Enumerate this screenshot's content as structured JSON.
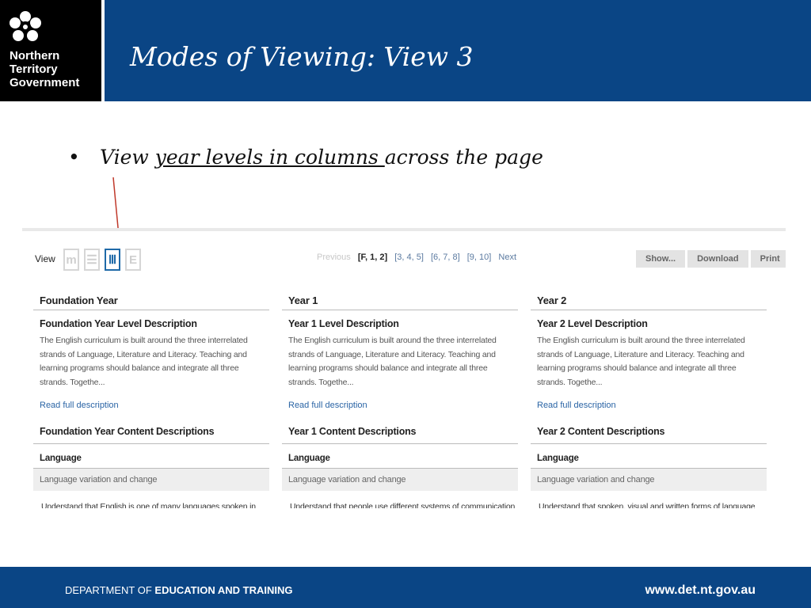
{
  "header": {
    "logo_lines": [
      "Northern",
      "Territory",
      "Government"
    ],
    "title": "Modes of Viewing: View 3"
  },
  "bullet": {
    "prefix": "View ",
    "underlined": "year levels in columns ",
    "suffix": "across the page"
  },
  "toolbar": {
    "view_label": "View",
    "view_icons": [
      {
        "name": "mixed-view-icon",
        "glyph": "m",
        "active": false
      },
      {
        "name": "rows-view-icon",
        "glyph": "☰",
        "active": false
      },
      {
        "name": "columns-view-icon",
        "glyph": "Ⅲ",
        "active": true
      },
      {
        "name": "elaborations-view-icon",
        "glyph": "E",
        "active": false
      }
    ],
    "pager": {
      "previous": "Previous",
      "pages": [
        "[F, 1, 2]",
        "[3, 4, 5]",
        "[6, 7, 8]",
        "[9, 10]"
      ],
      "next": "Next"
    },
    "buttons": [
      "Show...",
      "Download",
      "Print"
    ]
  },
  "columns": [
    {
      "heading": "Foundation Year",
      "level_heading": "Foundation Year Level Description",
      "description": "The English curriculum is built around the three interrelated strands of Language, Literature and Literacy. Teaching and learning programs should balance and integrate all three strands. Togethe...",
      "read_more": "Read full description",
      "content_heading": "Foundation Year Content Descriptions",
      "strand": "Language",
      "sub_strand": "Language variation and change",
      "cut_text": "Understand that English is one of many languages spoken in"
    },
    {
      "heading": "Year 1",
      "level_heading": "Year 1 Level Description",
      "description": "The English curriculum is built around the three interrelated strands of Language, Literature and Literacy. Teaching and learning programs should balance and integrate all three strands. Togethe...",
      "read_more": "Read full description",
      "content_heading": "Year 1 Content Descriptions",
      "strand": "Language",
      "sub_strand": "Language variation and change",
      "cut_text": "Understand that people use different systems of communication"
    },
    {
      "heading": "Year 2",
      "level_heading": "Year 2 Level Description",
      "description": "The English curriculum is built around the three interrelated strands of Language, Literature and Literacy. Teaching and learning programs should balance and integrate all three strands. Togethe...",
      "read_more": "Read full description",
      "content_heading": "Year 2 Content Descriptions",
      "strand": "Language",
      "sub_strand": "Language variation and change",
      "cut_text": "Understand that spoken, visual and written forms of language"
    }
  ],
  "footer": {
    "dept_prefix": "DEPARTMENT OF ",
    "dept_name": "EDUCATION AND TRAINING",
    "url": "www.det.nt.gov.au"
  },
  "colors": {
    "brand_blue": "#0a4585",
    "link_blue": "#2a64a5",
    "annotation_arrow": "#c0392b"
  }
}
